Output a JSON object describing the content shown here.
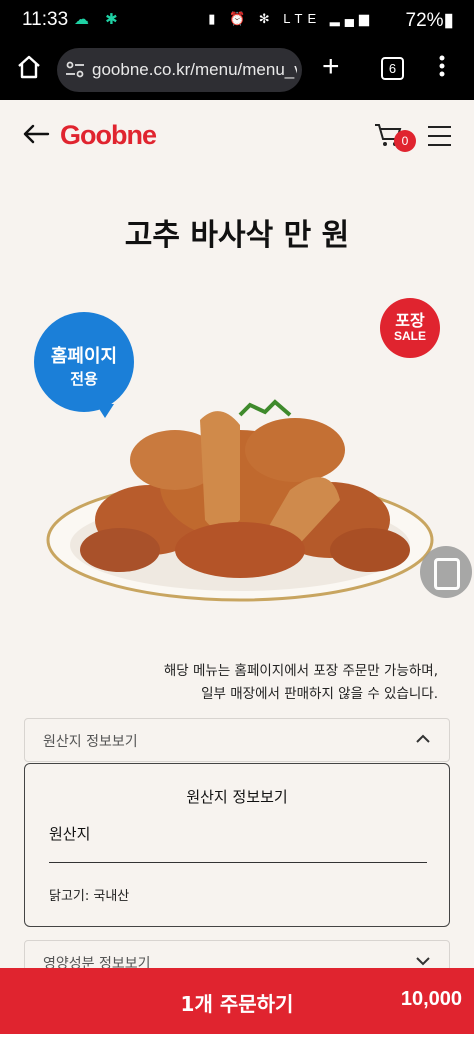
{
  "status_bar": {
    "time": "11:33",
    "battery": "72%",
    "network": "LTE"
  },
  "browser": {
    "url": "goobne.co.kr/menu/menu_view",
    "tab_count": "6"
  },
  "header": {
    "logo": "Goobne",
    "cart_count": "0"
  },
  "product": {
    "title": "고추 바사삭 만 원",
    "badge_homepage_line1": "홈페이지",
    "badge_homepage_line2": "전용",
    "badge_takeout_line1": "포장",
    "badge_takeout_line2": "SALE",
    "notice_line1": "해당 메뉴는 홈페이지에서 포장 주문만 가능하며,",
    "notice_line2": "일부 매장에서 판매하지 않을 수 있습니다."
  },
  "origin_accordion": {
    "label": "원산지 정보보기",
    "panel_title": "원산지 정보보기",
    "panel_subtitle": "원산지",
    "panel_value": "닭고기: 국내산"
  },
  "nutrition_accordion": {
    "label": "영양성분 정보보기"
  },
  "order": {
    "label": "1개 주문하기",
    "price": "10,000"
  },
  "colors": {
    "brand_red": "#e0242f",
    "badge_blue": "#1b7fd8",
    "background": "#f7f3ef"
  }
}
